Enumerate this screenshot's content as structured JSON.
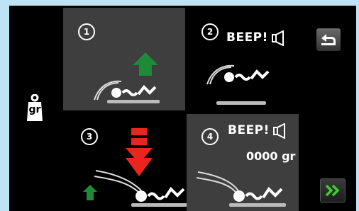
{
  "sidebar": {
    "unit_label": "gr"
  },
  "steps": [
    {
      "number": "1"
    },
    {
      "number": "2",
      "beep_text": "BEEP!"
    },
    {
      "number": "3"
    },
    {
      "number": "4",
      "beep_text": "BEEP!",
      "weight_value": "0000 gr"
    }
  ],
  "colors": {
    "arrow_green": "#1f8a3a",
    "arrow_red": "#e8261f",
    "next_green": "#3ad12c"
  },
  "icons": {
    "back": "back-arrow-icon",
    "next": "double-chevron-right-icon",
    "weight": "scale-weight-icon",
    "speaker": "speaker-icon"
  }
}
